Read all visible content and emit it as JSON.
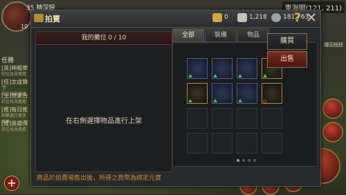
{
  "hud": {
    "level": "35",
    "level_label": "轉深歸",
    "level_num": "10",
    "quest_tab": "任務",
    "quests": [
      {
        "title": "[英]神殿樂",
        "sub": "前往找見擔擔"
      },
      {
        "title": "[任]太虛鋒下",
        "sub": "前往找見擔擔"
      },
      {
        "title": "[主]世家合",
        "sub": "前往找見擔擔"
      },
      {
        "title": "[推]每日推",
        "sub": "點擊進行更多推薦"
      },
      {
        "title": "[推]英雄傳",
        "sub": "前往找見擔擔"
      }
    ],
    "map_title": "東海閣(121, 211)",
    "map_sub": "傳回按鈕"
  },
  "dialog": {
    "title": "拍賣",
    "currency": {
      "gold": "0",
      "silver": "1,218",
      "coins": "181,763"
    },
    "help_label": "?",
    "close_label": "✕",
    "left_panel": {
      "header": "我的攤位 0 / 10",
      "hint": "在右側選擇物品進行上架"
    },
    "notice": "商品於拍賣場售出後，所得之貨幣為綁定元寶",
    "tabs": [
      "全部",
      "裝備",
      "物品"
    ],
    "buy_label": "購買",
    "sell_label": "出售"
  },
  "inventory": [
    {
      "icon": "spear-icon",
      "marker": "green"
    },
    {
      "icon": "spear-icon",
      "marker": "green"
    },
    {
      "icon": "trident-icon",
      "marker": "green"
    },
    {
      "icon": "compass-disc-icon",
      "marker": "green"
    },
    {
      "icon": "compass-disc-icon",
      "marker": "green"
    },
    {
      "icon": "blue-belt-icon",
      "marker": "green"
    },
    {
      "icon": "armor-icon",
      "marker": "green"
    },
    {
      "icon": "bracelet-icon",
      "marker": "bind"
    }
  ],
  "colors": {
    "accent": "#d98a2a",
    "sell": "#7a2a22",
    "gold": "#e5b43a"
  }
}
